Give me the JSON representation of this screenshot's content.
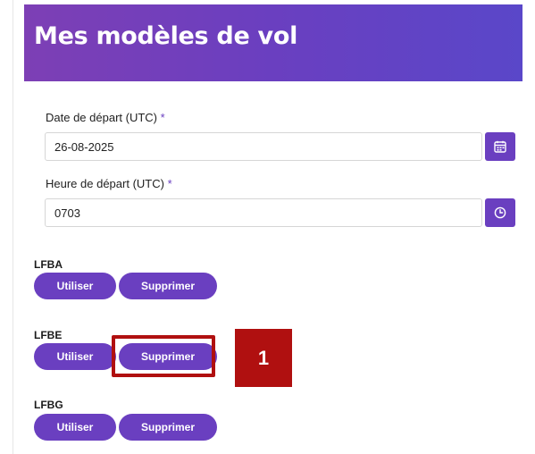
{
  "header": {
    "title": "Mes modèles de vol"
  },
  "form": {
    "date": {
      "label": "Date de départ (UTC)",
      "required_mark": "*",
      "value": "26-08-2025",
      "button_icon": "calendar-icon"
    },
    "time": {
      "label": "Heure de départ (UTC)",
      "required_mark": "*",
      "value": "0703",
      "button_icon": "clock-icon"
    }
  },
  "templates": [
    {
      "name": "LFBA",
      "use_label": "Utiliser",
      "delete_label": "Supprimer"
    },
    {
      "name": "LFBE",
      "use_label": "Utiliser",
      "delete_label": "Supprimer"
    },
    {
      "name": "LFBG",
      "use_label": "Utiliser",
      "delete_label": "Supprimer"
    }
  ],
  "annotation": {
    "step_number": "1",
    "color": "#b01010"
  },
  "colors": {
    "accent": "#6a3fc0",
    "header_start": "#7d3fb5",
    "header_end": "#5a47c9"
  }
}
